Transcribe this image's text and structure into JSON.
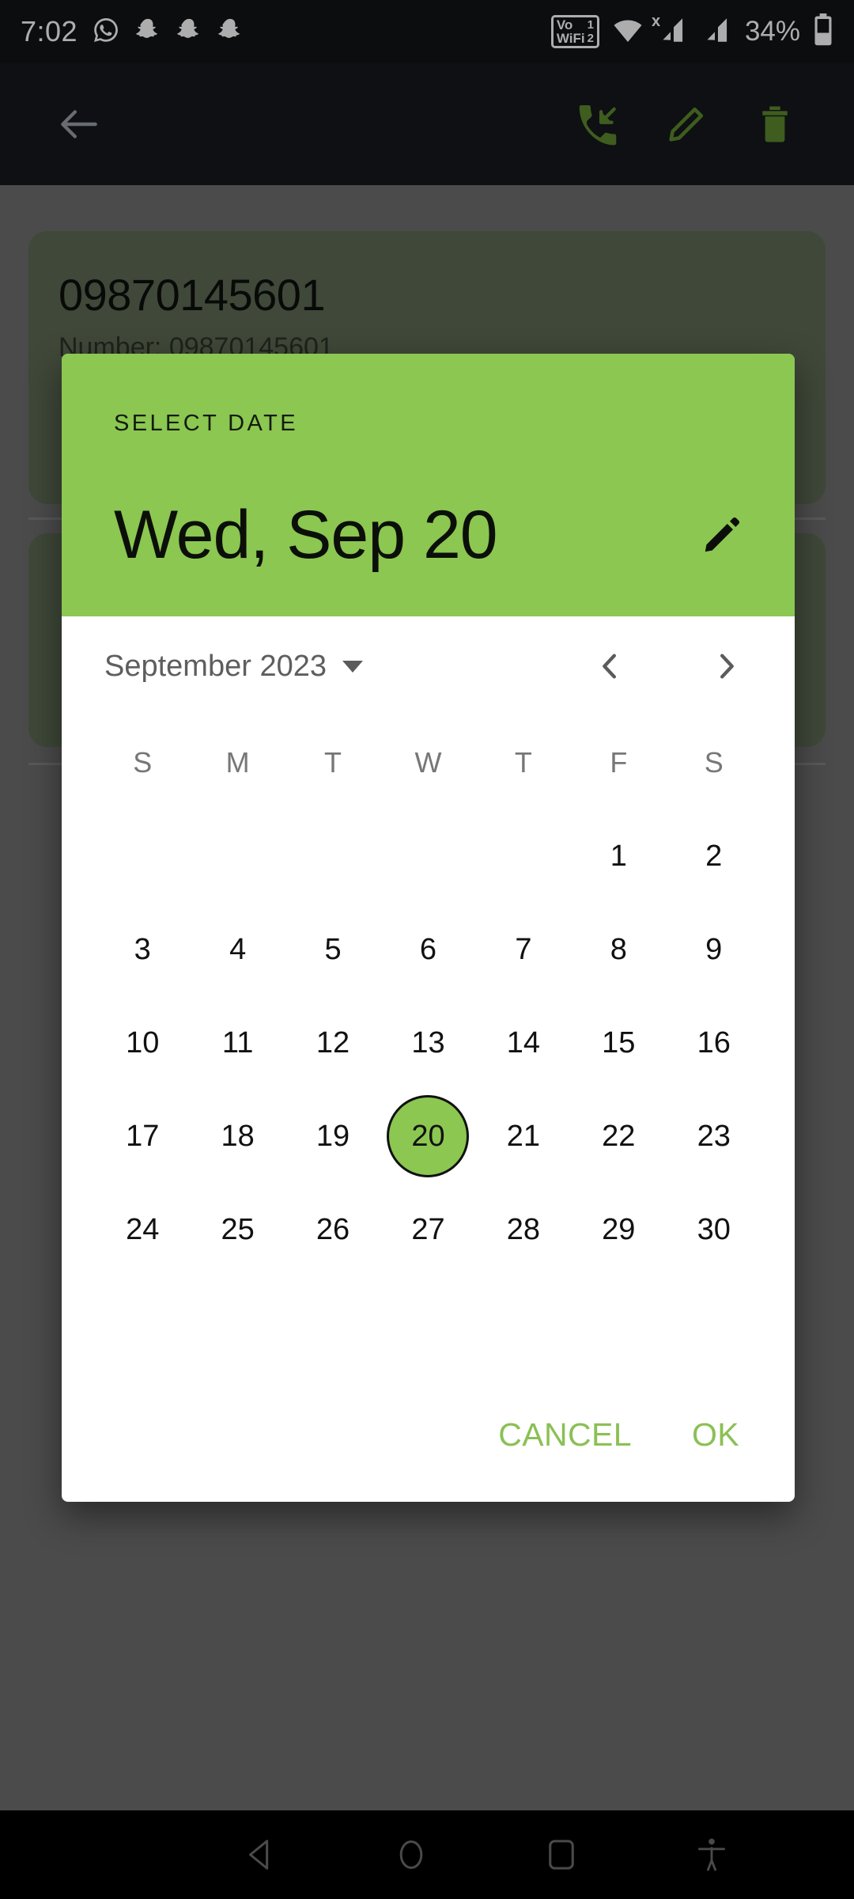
{
  "status_bar": {
    "time": "7:02",
    "left_icons": [
      "whatsapp-icon",
      "snapchat-icon",
      "snapchat-icon",
      "snapchat-icon"
    ],
    "vowifi": {
      "line1": "Vo",
      "line2": "WiFi",
      "num1": "1",
      "num2": "2"
    },
    "right_icons": [
      "vowifi-indicator",
      "wifi-icon",
      "signal-1-no-service-icon",
      "signal-2-icon"
    ],
    "battery_percent": "34%",
    "background": "#111417"
  },
  "app_bar": {
    "back_label": "back-arrow",
    "actions": [
      {
        "name": "call-received-button",
        "label": "call"
      },
      {
        "name": "edit-button",
        "label": "edit"
      },
      {
        "name": "delete-button",
        "label": "delete"
      }
    ],
    "accent": "#5c8a2e",
    "background": "#16191c"
  },
  "background_content": {
    "card_1": {
      "title": "09870145601",
      "subtitle": "Number: 09870145601"
    },
    "card_2": {
      "title": "",
      "subtitle": ""
    }
  },
  "dialog": {
    "label": "SELECT DATE",
    "selected_date_text": "Wed, Sep 20",
    "edit_icon": "pencil-icon",
    "accent_color": "#8bc751",
    "month_label": "September 2023",
    "prev_label": "‹",
    "next_label": "›",
    "weekdays": [
      "S",
      "M",
      "T",
      "W",
      "T",
      "F",
      "S"
    ],
    "weeks": [
      [
        "",
        "",
        "",
        "",
        "",
        "1",
        "2"
      ],
      [
        "3",
        "4",
        "5",
        "6",
        "7",
        "8",
        "9"
      ],
      [
        "10",
        "11",
        "12",
        "13",
        "14",
        "15",
        "16"
      ],
      [
        "17",
        "18",
        "19",
        "20",
        "21",
        "22",
        "23"
      ],
      [
        "24",
        "25",
        "26",
        "27",
        "28",
        "29",
        "30"
      ],
      [
        "",
        "",
        "",
        "",
        "",
        "",
        ""
      ]
    ],
    "selected_day": "20",
    "cancel_label": "CANCEL",
    "ok_label": "OK"
  },
  "nav_bar": {
    "buttons": [
      "back-triangle-icon",
      "home-circle-icon",
      "recents-square-icon",
      "accessibility-icon"
    ],
    "background": "#000000"
  }
}
